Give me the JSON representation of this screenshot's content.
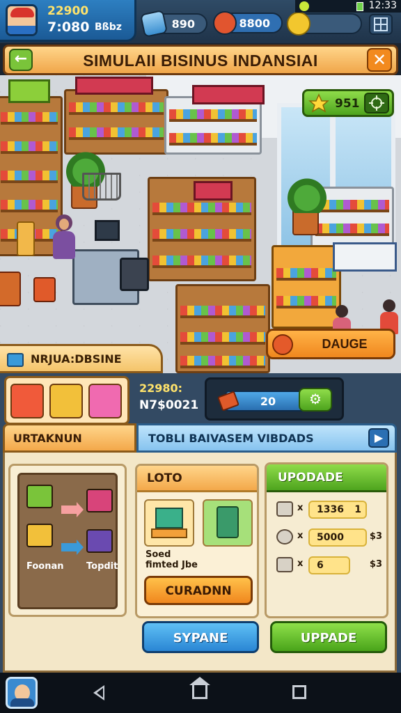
{
  "status_bar": {
    "time": "12:33"
  },
  "hud": {
    "cash": "22900",
    "clock": "7:080",
    "clock_suffix": "Bßbz",
    "pill_a": "890",
    "pill_b": "8800",
    "pill_c": ""
  },
  "title": "SIMULAII BISINUS INDANSIAI",
  "scene": {
    "star_count": "951",
    "action_button": "DAUGE",
    "store_name": "NRJUA:DBSINE",
    "signs": [
      "",
      "",
      ""
    ]
  },
  "inventory": {
    "stat_1": "22980:",
    "stat_2": "N7$0021",
    "progress_value": "20",
    "progress_percent": 60
  },
  "tabs": {
    "left": "URTAKNUN",
    "right": "TOBLI BAIVASEM VIBDADS"
  },
  "craft": {
    "from_label": "Foonan",
    "to_label": "Topdit"
  },
  "loto": {
    "title": "LOTO",
    "caption": "Soed fimted Jbe",
    "button": "CURADNN"
  },
  "upgrade": {
    "title": "UPODADE",
    "rows": [
      {
        "x": "x",
        "value": "1336",
        "level": "1",
        "cost": ""
      },
      {
        "x": "x",
        "value": "5000",
        "level": "",
        "cost": "$3"
      },
      {
        "x": "x",
        "value": "6",
        "level": "",
        "cost": "$3"
      }
    ]
  },
  "buttons": {
    "left": "SYPANE",
    "right": "UPPADE"
  },
  "colors": {
    "accent_orange": "#f0871e",
    "accent_green": "#4ea41e",
    "accent_blue": "#2a86d4",
    "hud_blue": "#1b5a96"
  }
}
